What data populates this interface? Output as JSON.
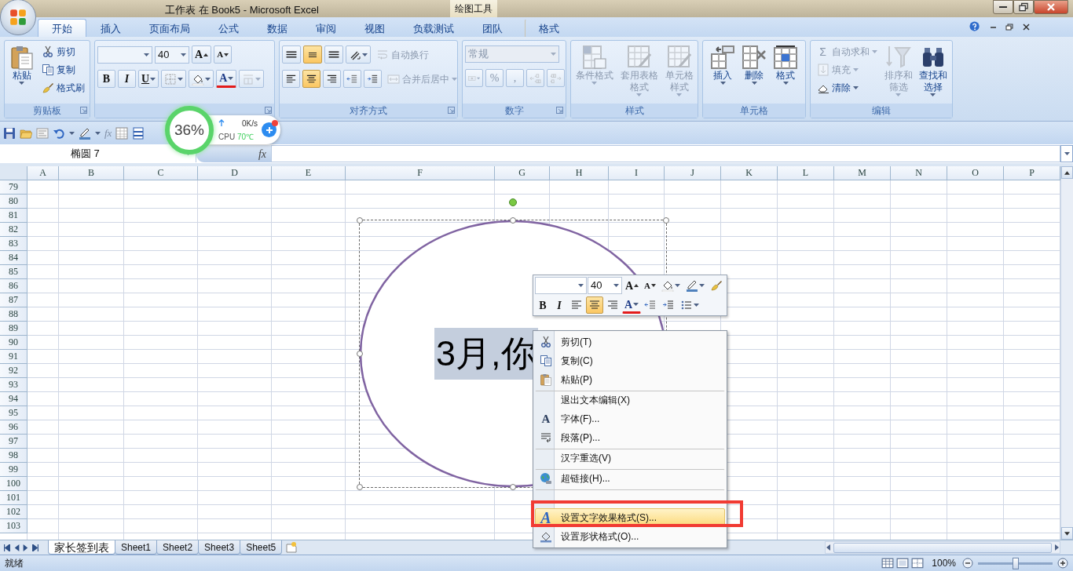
{
  "window": {
    "title": "工作表 在 Book5  -  Microsoft Excel",
    "context_label": "绘图工具"
  },
  "tabs": [
    {
      "label": "开始",
      "selected": true,
      "kind": "normal"
    },
    {
      "label": "插入",
      "selected": false,
      "kind": "normal"
    },
    {
      "label": "页面布局",
      "selected": false,
      "kind": "normal"
    },
    {
      "label": "公式",
      "selected": false,
      "kind": "normal"
    },
    {
      "label": "数据",
      "selected": false,
      "kind": "normal"
    },
    {
      "label": "审阅",
      "selected": false,
      "kind": "normal"
    },
    {
      "label": "视图",
      "selected": false,
      "kind": "normal"
    },
    {
      "label": "负载测试",
      "selected": false,
      "kind": "normal"
    },
    {
      "label": "团队",
      "selected": false,
      "kind": "normal"
    },
    {
      "label": "格式",
      "selected": false,
      "kind": "contextual"
    }
  ],
  "ribbon": {
    "groups": [
      {
        "title": "剪贴板",
        "launcher": true,
        "columns": [
          [
            {
              "kind": "paste",
              "label": "粘贴",
              "dropdown": true,
              "disabled": false
            }
          ],
          [
            {
              "kind": "cut",
              "label": "剪切",
              "dropdown": false,
              "disabled": false
            },
            {
              "kind": "copy",
              "label": "复制",
              "dropdown": false,
              "disabled": false
            },
            {
              "kind": "format-painter",
              "label": "格式刷",
              "dropdown": false,
              "disabled": false
            }
          ]
        ]
      },
      {
        "launcher": true,
        "rows": [
          [
            {
              "kind": "font-name",
              "dropdown": true,
              "disabled": false
            },
            {
              "kind": "font-size",
              "value": "40",
              "dropdown": true,
              "disabled": false
            },
            {
              "kind": "grow-font",
              "label": "A",
              "dropdown": false,
              "disabled": false
            },
            {
              "kind": "shrink-font",
              "label": "A",
              "dropdown": false,
              "disabled": false
            }
          ],
          [
            {
              "kind": "bold",
              "label": "B",
              "dropdown": false,
              "disabled": false
            },
            {
              "kind": "italic",
              "label": "I",
              "dropdown": false,
              "disabled": false
            },
            {
              "kind": "underline",
              "label": "U",
              "dropdown": true,
              "disabled": false
            },
            {
              "kind": "border",
              "dropdown": true,
              "disabled": false
            },
            {
              "kind": "fill-color",
              "dropdown": true,
              "disabled": false
            },
            {
              "kind": "font-color",
              "label": "A",
              "dropdown": true,
              "disabled": false
            },
            {
              "kind": "phonetic",
              "dropdown": true,
              "disabled": true
            }
          ]
        ]
      },
      {
        "title": "对齐方式",
        "launcher": true,
        "rows": [
          [
            {
              "kind": "align-top",
              "selected": false,
              "dropdown": false,
              "disabled": false
            },
            {
              "kind": "align-middle",
              "selected": true,
              "dropdown": false,
              "disabled": false
            },
            {
              "kind": "align-bottom",
              "selected": false,
              "dropdown": false,
              "disabled": false
            },
            {
              "kind": "orientation",
              "dropdown": true,
              "disabled": false
            },
            {
              "kind": "wrap-text",
              "label": "自动换行",
              "dropdown": false,
              "disabled": true
            }
          ],
          [
            {
              "kind": "align-left",
              "selected": false,
              "dropdown": false,
              "disabled": false
            },
            {
              "kind": "align-center",
              "selected": true,
              "dropdown": false,
              "disabled": false
            },
            {
              "kind": "align-right",
              "selected": false,
              "dropdown": false,
              "disabled": false
            },
            {
              "kind": "outdent",
              "dropdown": false,
              "disabled": false
            },
            {
              "kind": "indent",
              "dropdown": false,
              "disabled": false
            },
            {
              "kind": "merge",
              "label": "合并后居中",
              "dropdown": true,
              "disabled": true
            }
          ]
        ]
      },
      {
        "title": "数字",
        "launcher": true,
        "rows": [
          [
            {
              "kind": "number-format",
              "value": "常规",
              "dropdown": true,
              "disabled": true
            }
          ],
          [
            {
              "kind": "currency",
              "dropdown": true,
              "disabled": true
            },
            {
              "kind": "percent",
              "label": "%",
              "dropdown": false,
              "disabled": true
            },
            {
              "kind": "comma",
              "label": ",",
              "dropdown": false,
              "disabled": true
            },
            {
              "kind": "increase-decimal",
              "dropdown": false,
              "disabled": true
            },
            {
              "kind": "decrease-decimal",
              "dropdown": false,
              "disabled": true
            }
          ]
        ]
      },
      {
        "title": "样式",
        "launcher": false,
        "columns": [
          [
            {
              "kind": "conditional-format",
              "label": "条件格式",
              "dropdown": true,
              "disabled": true
            }
          ],
          [
            {
              "kind": "table-format",
              "label": "套用表格格式",
              "dropdown": true,
              "disabled": true
            }
          ],
          [
            {
              "kind": "cell-style",
              "label": "单元格样式",
              "dropdown": true,
              "disabled": true
            }
          ]
        ]
      },
      {
        "title": "单元格",
        "launcher": false,
        "columns": [
          [
            {
              "kind": "insert-cells",
              "label": "插入",
              "dropdown": true,
              "disabled": false
            }
          ],
          [
            {
              "kind": "delete-cells",
              "label": "删除",
              "dropdown": true,
              "disabled": false
            }
          ],
          [
            {
              "kind": "format-cells",
              "label": "格式",
              "dropdown": true,
              "disabled": false
            }
          ]
        ]
      },
      {
        "title": "编辑",
        "launcher": false,
        "columns": [
          [
            {
              "kind": "autosum",
              "symbol": "Σ",
              "label": "自动求和",
              "dropdown": true,
              "disabled": true
            },
            {
              "kind": "fill-down",
              "label": "填充",
              "dropdown": true,
              "disabled": true
            },
            {
              "kind": "clear",
              "label": "清除",
              "dropdown": true,
              "disabled": false
            }
          ],
          [
            {
              "kind": "sort-filter",
              "label": "排序和筛选",
              "dropdown": true,
              "disabled": true
            }
          ],
          [
            {
              "kind": "find-select",
              "label": "查找和选择",
              "dropdown": true,
              "disabled": false
            }
          ]
        ]
      }
    ]
  },
  "quick_access": {
    "function_label": "fx"
  },
  "name_box": {
    "value": "椭圆 7"
  },
  "formula_bar": {
    "function_label": "fx"
  },
  "system_monitor": {
    "percent": "36%",
    "speed": "0K/s",
    "cpu_label": "CPU",
    "temperature": "70℃"
  },
  "sheet": {
    "columns": [
      "A",
      "B",
      "C",
      "D",
      "E",
      "F",
      "G",
      "H",
      "I",
      "J",
      "K",
      "L",
      "M",
      "N",
      "O",
      "P"
    ],
    "rows": [
      "79",
      "80",
      "81",
      "82",
      "83",
      "84",
      "85",
      "86",
      "87",
      "88",
      "89",
      "90",
      "91",
      "92",
      "93",
      "94",
      "95",
      "96",
      "97",
      "98",
      "99",
      "100",
      "101",
      "102",
      "103"
    ],
    "shape": {
      "text": "3月,你",
      "selected": true,
      "text_selected": true
    }
  },
  "mini_toolbar": {
    "rows": [
      [
        {
          "kind": "font-name",
          "dropdown": true,
          "disabled": false
        },
        {
          "kind": "font-size",
          "value": "40",
          "dropdown": true,
          "disabled": false
        },
        {
          "kind": "grow-font",
          "label": "A",
          "dropdown": false,
          "disabled": false
        },
        {
          "kind": "shrink-font",
          "label": "A",
          "dropdown": false,
          "disabled": false
        },
        {
          "kind": "fill-color",
          "dropdown": true,
          "disabled": false
        },
        {
          "kind": "line-color",
          "dropdown": true,
          "disabled": false
        },
        {
          "kind": "painter",
          "dropdown": false,
          "disabled": false
        }
      ],
      [
        {
          "kind": "bold",
          "label": "B",
          "dropdown": false,
          "disabled": false
        },
        {
          "kind": "italic",
          "label": "I",
          "dropdown": false,
          "disabled": false
        },
        {
          "kind": "align-left",
          "selected": false,
          "dropdown": false,
          "disabled": false
        },
        {
          "kind": "align-center",
          "selected": true,
          "dropdown": false,
          "disabled": false
        },
        {
          "kind": "align-right",
          "selected": false,
          "dropdown": false,
          "disabled": false
        },
        {
          "kind": "font-color",
          "label": "A",
          "dropdown": true,
          "disabled": false
        },
        {
          "kind": "outdent",
          "dropdown": false,
          "disabled": false
        },
        {
          "kind": "indent",
          "dropdown": false,
          "disabled": false
        },
        {
          "kind": "bullets",
          "dropdown": true,
          "disabled": false
        }
      ]
    ]
  },
  "context_menu": {
    "items": [
      {
        "label": "剪切(T)",
        "kind": "cut",
        "separator_before": false,
        "highlighted": false
      },
      {
        "label": "复制(C)",
        "kind": "copy",
        "separator_before": false,
        "highlighted": false
      },
      {
        "label": "粘贴(P)",
        "kind": "paste",
        "separator_before": false,
        "highlighted": false
      },
      {
        "label": "退出文本编辑(X)",
        "kind": "plain",
        "separator_before": true,
        "highlighted": false
      },
      {
        "label": "字体(F)...",
        "kind": "letter",
        "icon_text": "A",
        "separator_before": false,
        "highlighted": false
      },
      {
        "label": "段落(P)...",
        "kind": "paragraph",
        "separator_before": false,
        "highlighted": false
      },
      {
        "label": "汉字重选(V)",
        "kind": "plain",
        "separator_before": true,
        "highlighted": false
      },
      {
        "label": "超链接(H)...",
        "kind": "globe",
        "separator_before": true,
        "highlighted": false
      },
      {
        "kind": "covered",
        "separator_before": true,
        "highlighted": false
      },
      {
        "label": "设置文字效果格式(S)...",
        "kind": "wordart",
        "icon_text": "A",
        "separator_before": false,
        "highlighted": true
      },
      {
        "label": "设置形状格式(O)...",
        "kind": "shape-format",
        "separator_before": false,
        "highlighted": false
      }
    ]
  },
  "sheet_tabs": [
    {
      "label": "家长签到表",
      "selected": true
    },
    {
      "label": "Sheet1",
      "selected": false
    },
    {
      "label": "Sheet2",
      "selected": false
    },
    {
      "label": "Sheet3",
      "selected": false
    },
    {
      "label": "Sheet5",
      "selected": false
    }
  ],
  "status_bar": {
    "text": "就绪",
    "zoom": "100%",
    "level": 0.5
  }
}
